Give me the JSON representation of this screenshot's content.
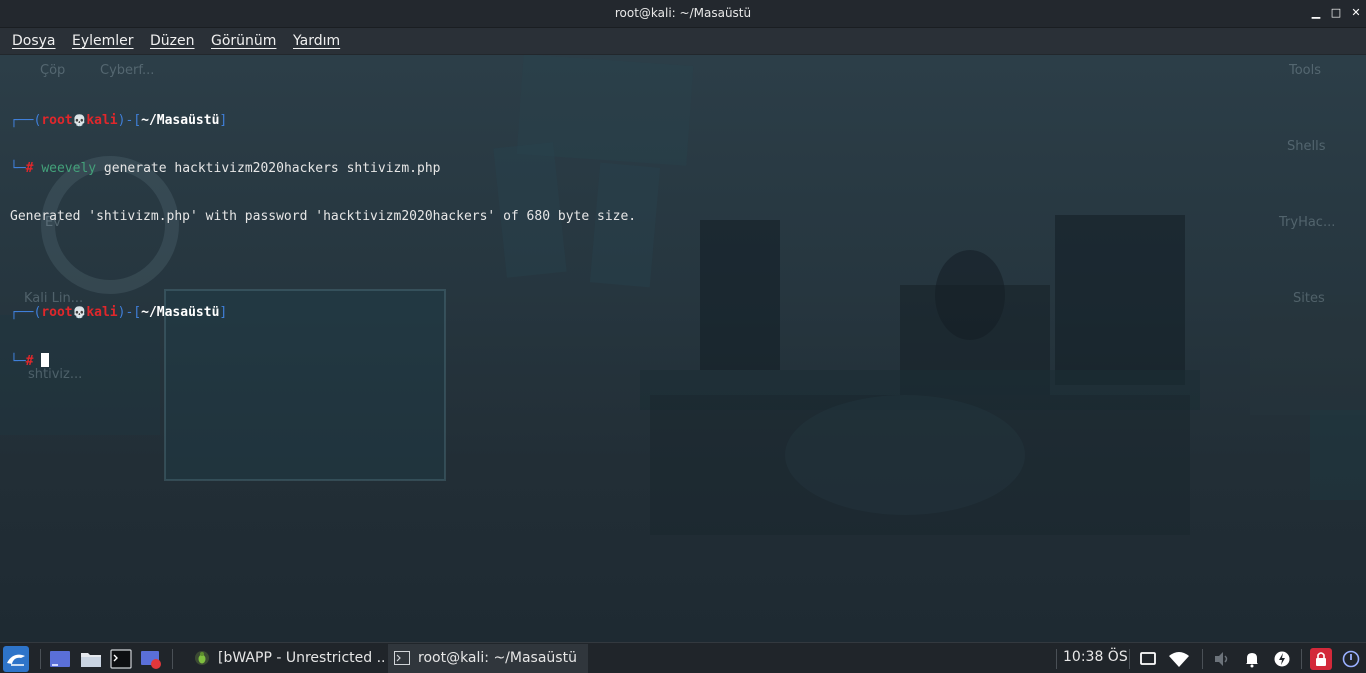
{
  "window": {
    "title": "root@kali: ~/Masaüstü",
    "controls": {
      "minimize": "▁",
      "maximize": "□",
      "close": "✕"
    }
  },
  "menu": {
    "items": [
      "Dosya",
      "Eylemler",
      "Düzen",
      "Görünüm",
      "Yardım"
    ]
  },
  "desktop_icons": [
    "Çöp",
    "Cyberf...",
    "Ev",
    "Kali Lin...",
    "shtiviz...",
    "Tools",
    "Shells",
    "TryHac...",
    "Sites"
  ],
  "terminal": {
    "prompt1": {
      "open": "┌──(",
      "user": "root",
      "skull": "💀",
      "host": "kali",
      "mid": ")-[",
      "path": "~/Masaüstü",
      "close": "]"
    },
    "line2_prefix": "└─",
    "hash": "#",
    "command_name": "weevely",
    "command_args": " generate hacktivizm2020hackers shtivizm.php",
    "output": "Generated 'shtivizm.php' with password 'hacktivizm2020hackers' of 680 byte size.",
    "prompt2": {
      "open": "┌──(",
      "user": "root",
      "skull": "💀",
      "host": "kali",
      "mid": ")-[",
      "path": "~/Masaüstü",
      "close": "]"
    }
  },
  "taskbar": {
    "tasks": [
      {
        "label": "[bWAPP - Unrestricted ...",
        "icon": "browser-icon"
      },
      {
        "label": "root@kali: ~/Masaüstü",
        "icon": "terminal-icon"
      }
    ],
    "clock": "10:38 ÖS"
  },
  "colors": {
    "prompt_frame": "#3f7fd9",
    "prompt_user": "#e0272b",
    "command": "#43a17a",
    "taskbar": "#20252a"
  }
}
